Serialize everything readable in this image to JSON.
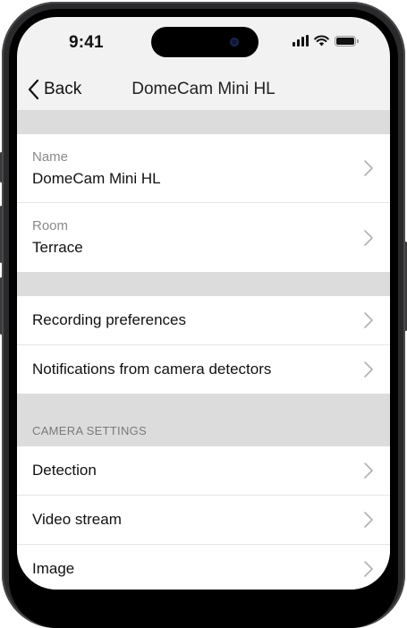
{
  "status_bar": {
    "time": "9:41",
    "icons": [
      "signal-icon",
      "wifi-icon",
      "battery-icon"
    ]
  },
  "nav": {
    "back_label": "Back",
    "title": "DomeCam Mini HL"
  },
  "general": {
    "name": {
      "label": "Name",
      "value": "DomeCam Mini HL"
    },
    "room": {
      "label": "Room",
      "value": "Terrace"
    }
  },
  "preferences": [
    {
      "label": "Recording preferences"
    },
    {
      "label": "Notifications from camera detectors"
    }
  ],
  "camera_settings": {
    "header": "CAMERA SETTINGS",
    "items": [
      {
        "label": "Detection"
      },
      {
        "label": "Video stream"
      },
      {
        "label": "Image"
      }
    ]
  },
  "colors": {
    "background": "#f2f2f2",
    "separator": "#dcdcdc",
    "chevron": "#b0b0b0",
    "text": "#111111",
    "secondary_text": "#8a8a8a"
  }
}
